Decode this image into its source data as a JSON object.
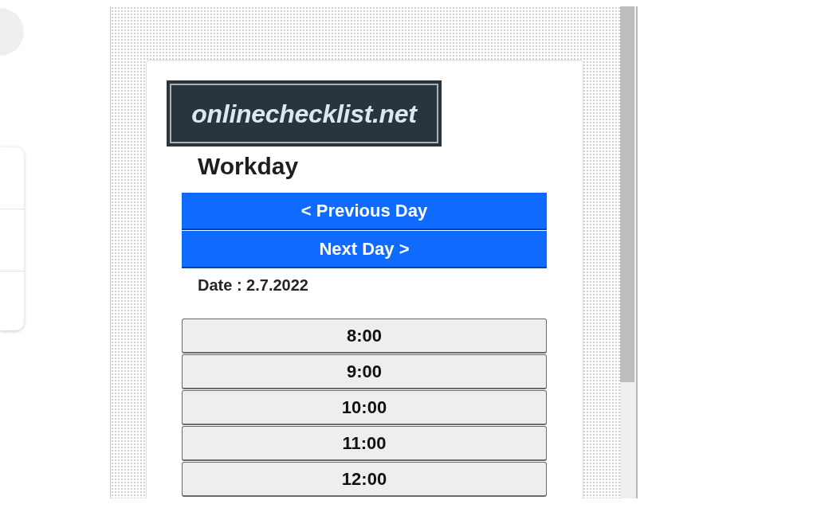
{
  "logo": {
    "text": "onlinechecklist.net"
  },
  "heading": "Workday",
  "day_nav": [
    {
      "label": "< Previous Day"
    },
    {
      "label": "Next Day >"
    }
  ],
  "date_label": "Date : 2.7.2022",
  "time_slots": [
    {
      "label": "8:00"
    },
    {
      "label": "9:00"
    },
    {
      "label": "10:00"
    },
    {
      "label": "11:00"
    },
    {
      "label": "12:00"
    }
  ]
}
